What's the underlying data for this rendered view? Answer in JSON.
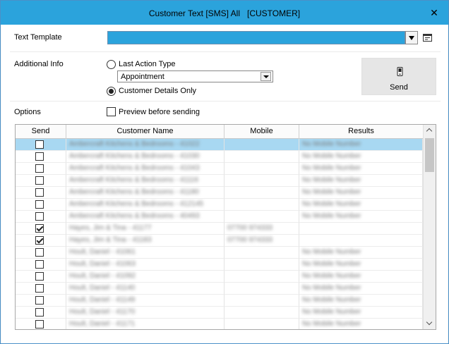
{
  "window": {
    "title": "Customer Text [SMS] All   [CUSTOMER]",
    "close_glyph": "✕"
  },
  "text_template": {
    "label": "Text Template",
    "value": "",
    "dropdown_icon": "dropdown-arrow-icon",
    "edit_icon": "template-edit-icon"
  },
  "additional_info": {
    "label": "Additional Info",
    "last_action_type": {
      "label": "Last Action Type",
      "selected": false
    },
    "action_type_combo": {
      "value": "Appointment"
    },
    "customer_details_only": {
      "label": "Customer Details Only",
      "selected": true
    }
  },
  "send_button": {
    "label": "Send",
    "icon": "mobile-phone-icon"
  },
  "options": {
    "label": "Options",
    "preview_before_sending": {
      "label": "Preview before sending",
      "checked": false
    }
  },
  "grid": {
    "columns": [
      "Send",
      "Customer Name",
      "Mobile",
      "Results"
    ],
    "rows": [
      {
        "send": false,
        "customer_name": "Ambercraft Kitchens & Bedrooms - 41022",
        "mobile": "",
        "results": "No Mobile Number",
        "selected": true
      },
      {
        "send": false,
        "customer_name": "Ambercraft Kitchens & Bedrooms - 41030",
        "mobile": "",
        "results": "No Mobile Number"
      },
      {
        "send": false,
        "customer_name": "Ambercraft Kitchens & Bedrooms - 41043",
        "mobile": "",
        "results": "No Mobile Number"
      },
      {
        "send": false,
        "customer_name": "Ambercraft Kitchens & Bedrooms - 41116",
        "mobile": "",
        "results": "No Mobile Number"
      },
      {
        "send": false,
        "customer_name": "Ambercraft Kitchens & Bedrooms - 41180",
        "mobile": "",
        "results": "No Mobile Number"
      },
      {
        "send": false,
        "customer_name": "Ambercraft Kitchens & Bedrooms - 412145",
        "mobile": "",
        "results": "No Mobile Number"
      },
      {
        "send": false,
        "customer_name": "Ambercraft Kitchens & Bedrooms - 40493",
        "mobile": "",
        "results": "No Mobile Number"
      },
      {
        "send": true,
        "customer_name": "Hayes, Jim & Tina - 41177",
        "mobile": "07700 974333",
        "results": ""
      },
      {
        "send": true,
        "customer_name": "Hayes, Jim & Tina - 41183",
        "mobile": "07700 974333",
        "results": ""
      },
      {
        "send": false,
        "customer_name": "Hoult, Daniel - 41061",
        "mobile": "",
        "results": "No Mobile Number"
      },
      {
        "send": false,
        "customer_name": "Hoult, Daniel - 41063",
        "mobile": "",
        "results": "No Mobile Number"
      },
      {
        "send": false,
        "customer_name": "Hoult, Daniel - 41092",
        "mobile": "",
        "results": "No Mobile Number"
      },
      {
        "send": false,
        "customer_name": "Hoult, Daniel - 41140",
        "mobile": "",
        "results": "No Mobile Number"
      },
      {
        "send": false,
        "customer_name": "Hoult, Daniel - 41149",
        "mobile": "",
        "results": "No Mobile Number"
      },
      {
        "send": false,
        "customer_name": "Hoult, Daniel - 41170",
        "mobile": "",
        "results": "No Mobile Number"
      },
      {
        "send": false,
        "customer_name": "Hoult, Daniel - 41171",
        "mobile": "",
        "results": "No Mobile Number"
      }
    ]
  },
  "colors": {
    "title_bar": "#2ba3dc",
    "template_field": "#2ba3dc",
    "selected_row": "#a8d8f2",
    "send_button_bg": "#e6e6e6"
  }
}
